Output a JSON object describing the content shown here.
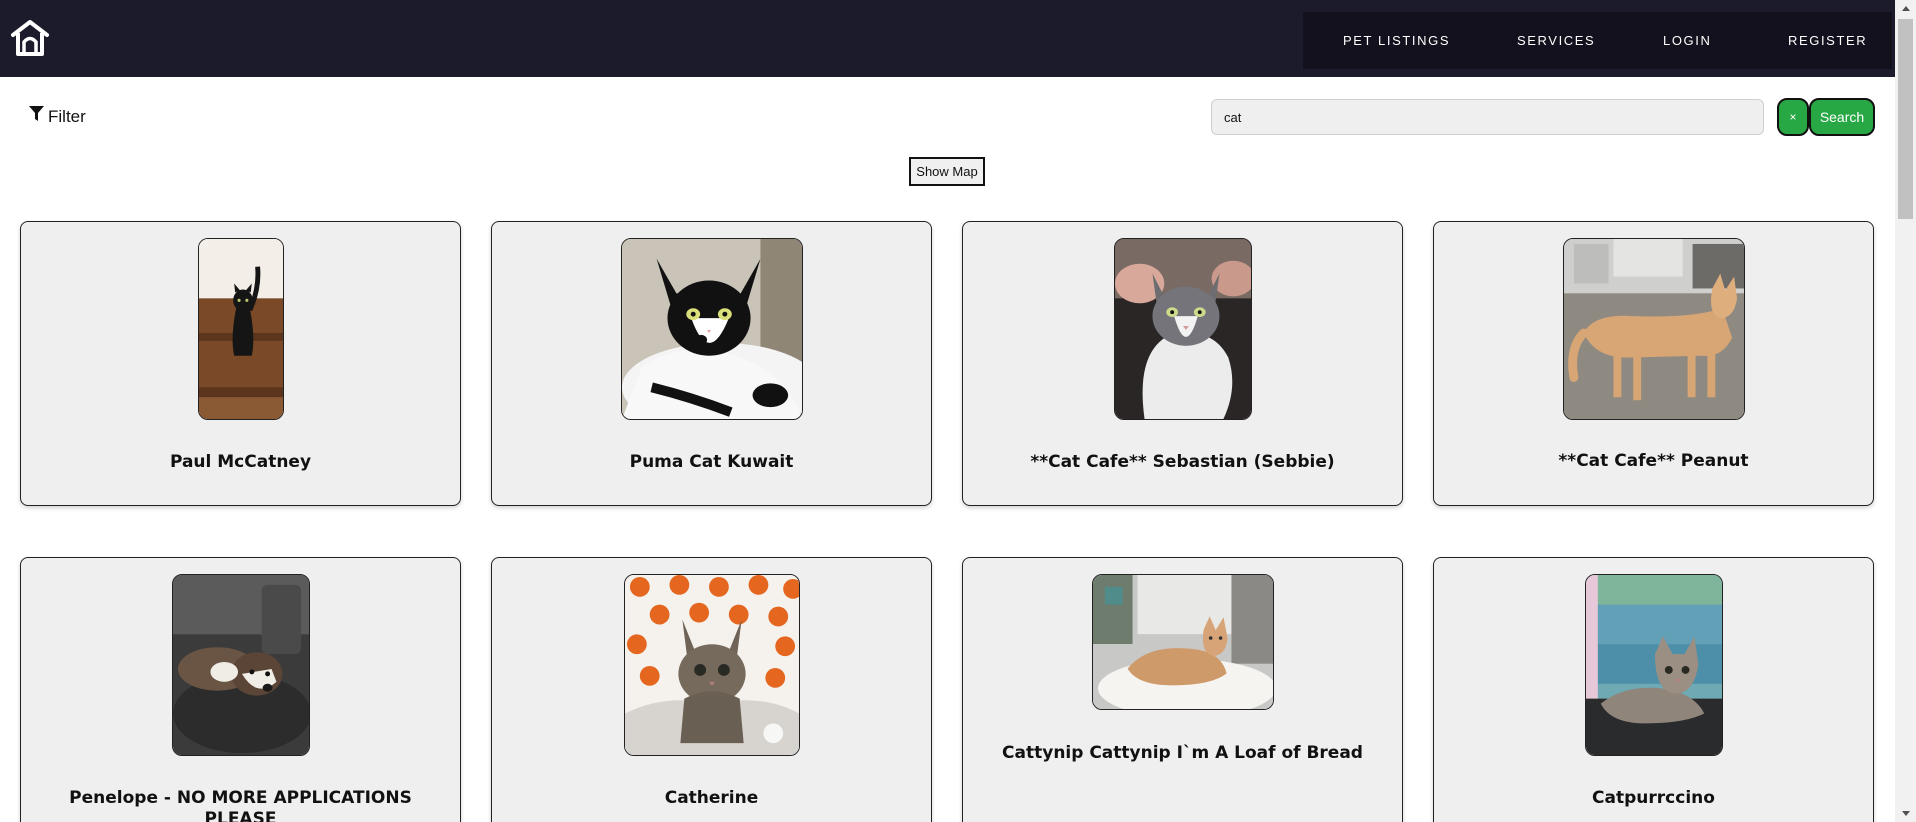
{
  "header": {
    "logo_icon": "house-icon",
    "nav": [
      {
        "label": "PET LISTINGS"
      },
      {
        "label": "SERVICES"
      },
      {
        "label": "LOGIN"
      },
      {
        "label": "REGISTER"
      }
    ]
  },
  "toolbar": {
    "filter_label": "Filter",
    "filter_icon": "filter-icon",
    "search_value": "cat",
    "clear_label": "×",
    "search_label": "Search",
    "show_map_label": "Show Map"
  },
  "colors": {
    "header_bg": "#1c1b2b",
    "nav_bg": "#12111d",
    "accent_green": "#27a844",
    "card_bg": "#efefef"
  },
  "pets": [
    {
      "name": "Paul McCatney",
      "photo": "black cat standing on wooden furniture"
    },
    {
      "name": "Puma Cat Kuwait",
      "photo": "black and white cat lying on cushion"
    },
    {
      "name": "**Cat Cafe** Sebastian (Sebbie)",
      "photo": "grey and white cat being held"
    },
    {
      "name": "**Cat Cafe** Peanut",
      "photo": "orange tabby cat standing on floor"
    },
    {
      "name": "Penelope - NO MORE APPLICATIONS PLEASE",
      "photo": "brown and white dog lying on seat"
    },
    {
      "name": "Catherine",
      "photo": "grey tabby kitten with pumpkin backdrop"
    },
    {
      "name": "Cattynip Cattynip I`m A Loaf of Bread",
      "photo": "orange cat crouching on white blanket"
    },
    {
      "name": "Catpurrccino",
      "photo": "tabby kitten lying on dark mat"
    }
  ]
}
